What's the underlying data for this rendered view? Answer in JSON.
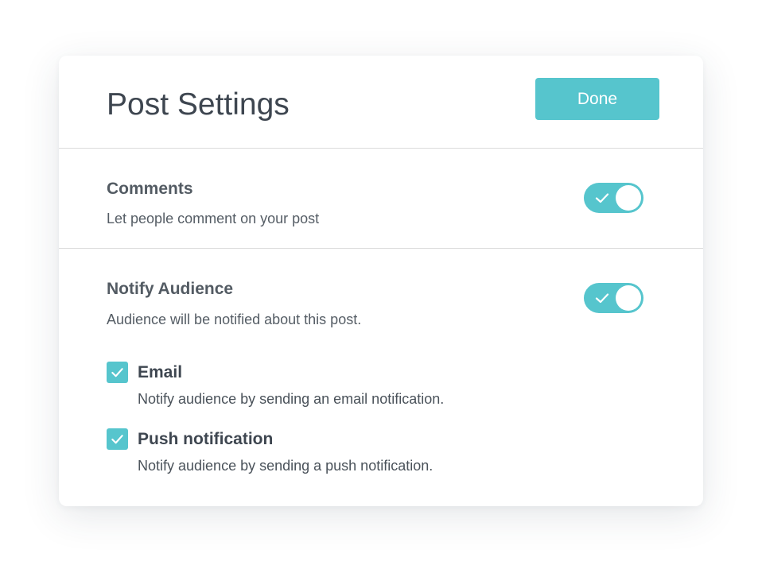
{
  "dialog": {
    "title": "Post Settings",
    "done_label": "Done"
  },
  "settings": {
    "comments": {
      "title": "Comments",
      "description": "Let people comment on your post",
      "enabled": true
    },
    "notify": {
      "title": "Notify Audience",
      "description": "Audience will be notified about this post.",
      "enabled": true,
      "options": [
        {
          "label": "Email",
          "description": "Notify audience by sending an email notification.",
          "checked": true
        },
        {
          "label": "Push notification",
          "description": "Notify audience by sending a push notification.",
          "checked": true
        }
      ]
    }
  },
  "icons": {
    "toggle_check": "checkmark-icon",
    "checkbox_check": "checkmark-icon"
  },
  "colors": {
    "accent": "#56c5cd",
    "title_text": "#3e4650",
    "body_text": "#555d65",
    "divider": "#dcdcdc"
  }
}
